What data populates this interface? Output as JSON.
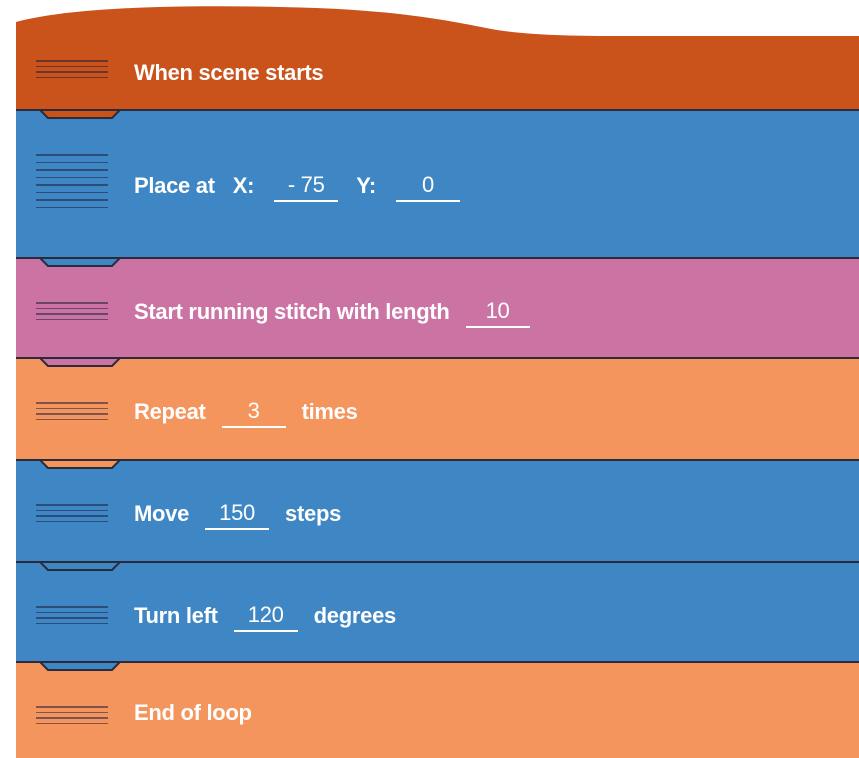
{
  "colors": {
    "event": "#c9531a",
    "motion": "#3e86c4",
    "stitch": "#cb74a3",
    "control": "#f4955e",
    "text": "#ffffff"
  },
  "blocks": {
    "when_scene_starts": {
      "label": "When scene starts"
    },
    "place_at": {
      "label": "Place at",
      "x_label": "X:",
      "x_value": "- 75",
      "y_label": "Y:",
      "y_value": "0"
    },
    "running_stitch": {
      "label": "Start running stitch with length",
      "length_value": "10"
    },
    "repeat": {
      "label": "Repeat",
      "count_value": "3",
      "suffix": "times"
    },
    "move": {
      "label": "Move",
      "steps_value": "150",
      "suffix": "steps"
    },
    "turn_left": {
      "label": "Turn left",
      "degrees_value": "120",
      "suffix": "degrees"
    },
    "end_of_loop": {
      "label": "End of loop"
    }
  },
  "icons": {
    "handle": "drag-handle-icon"
  }
}
